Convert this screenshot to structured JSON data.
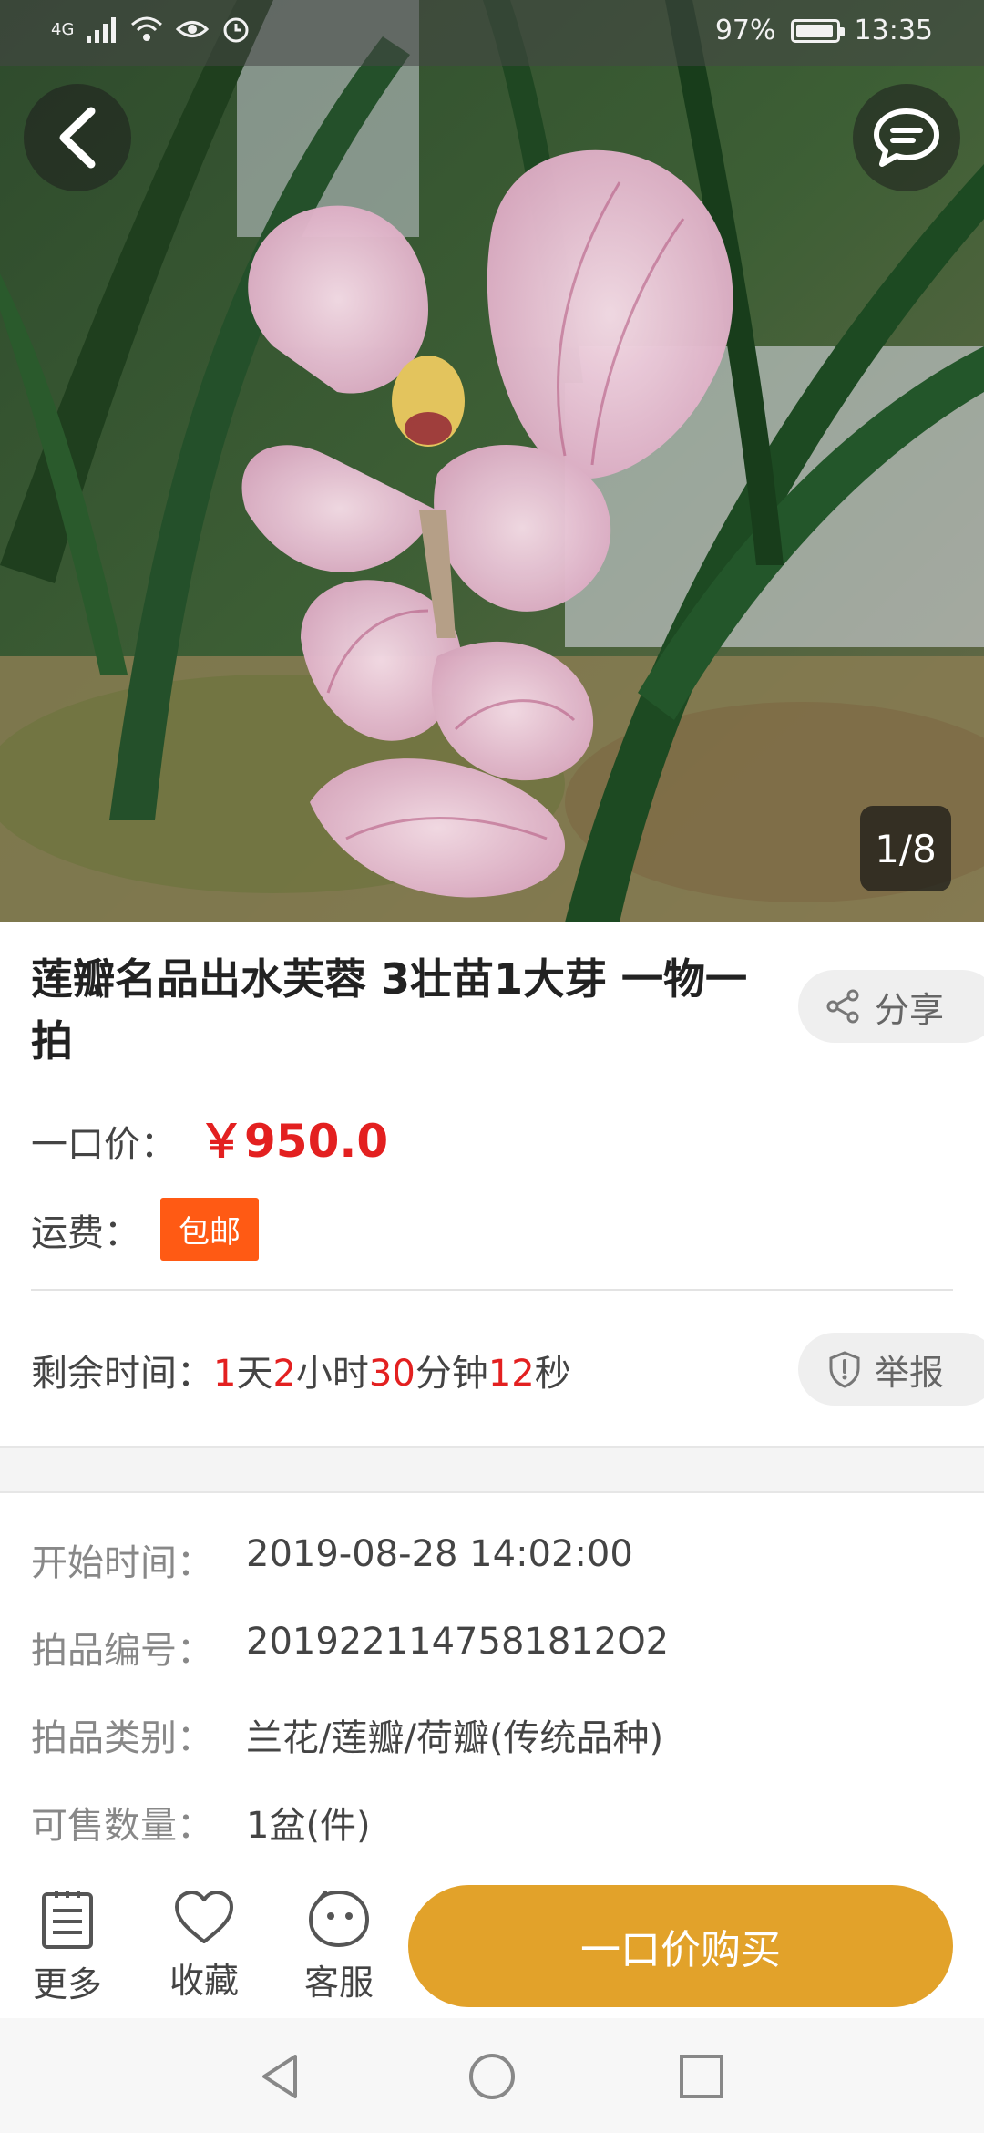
{
  "status_bar": {
    "network": "4G",
    "battery": "97%",
    "battery_level": 0.97,
    "time": "13:35"
  },
  "hero": {
    "page_indicator": "1/8",
    "back_icon": "chevron-left-icon",
    "chat_icon": "chat-bubble-icon"
  },
  "product": {
    "title": "莲瓣名品出水芙蓉 3壮苗1大芽 一物一拍",
    "share_label": "分享",
    "price_label": "一口价：",
    "price_value": "￥950.0",
    "shipping_label": "运费：",
    "shipping_badge": "包邮",
    "remaining_label": "剩余时间：",
    "remaining": {
      "days": "1",
      "days_unit": "天",
      "hours": "2",
      "hours_unit": "小时",
      "minutes": "30",
      "minutes_unit": "分钟",
      "seconds": "12",
      "seconds_unit": "秒"
    },
    "report_label": "举报"
  },
  "details": [
    {
      "key": "开始时间：",
      "value": "2019-08-28 14:02:00"
    },
    {
      "key": "拍品编号：",
      "value": "2019221147581812O2"
    },
    {
      "key": "拍品类别：",
      "value": "兰花/莲瓣/荷瓣(传统品种)"
    },
    {
      "key": "可售数量：",
      "value": "1盆(件)"
    }
  ],
  "bottom_bar": {
    "more": "更多",
    "favorite": "收藏",
    "service": "客服",
    "buy": "一口价购买"
  },
  "colors": {
    "price_red": "#e32020",
    "badge_orange": "#ff5a14",
    "buy_gold": "#e2a22a"
  }
}
